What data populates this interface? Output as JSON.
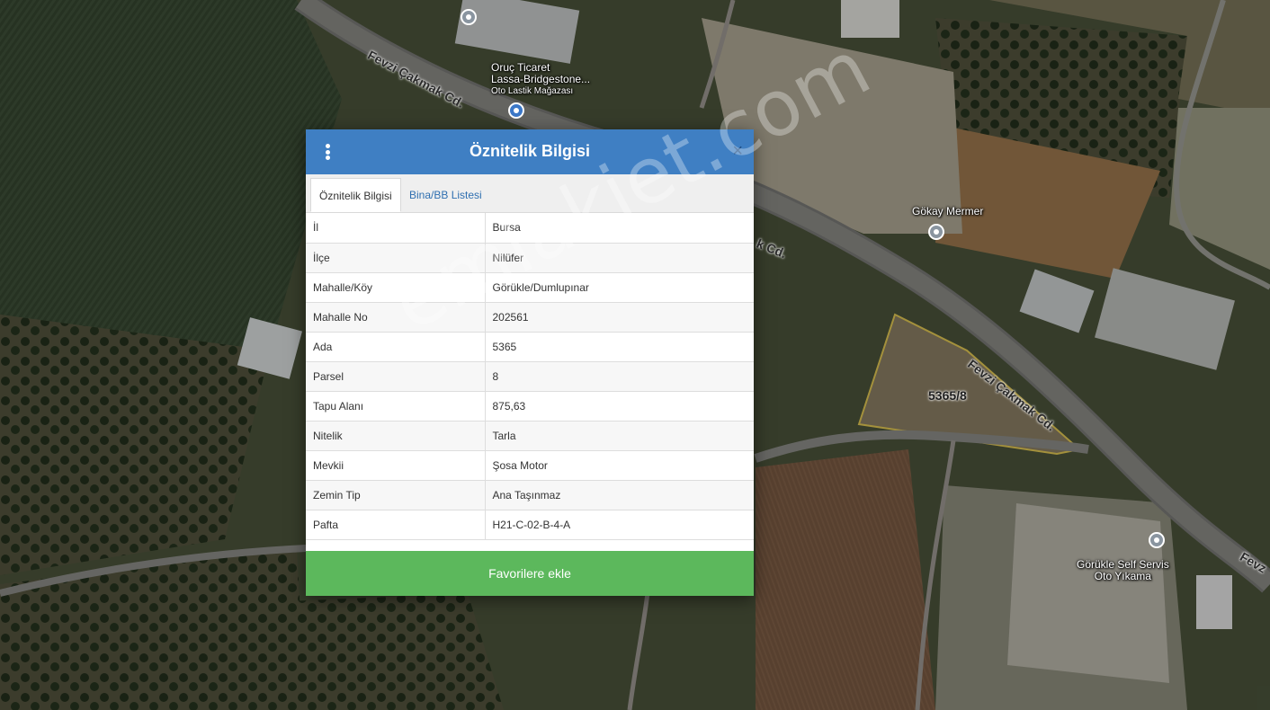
{
  "dialog": {
    "title": "Öznitelik Bilgisi",
    "menu_icon": "kebab-menu-icon",
    "close_label": "×",
    "tabs": [
      {
        "label": "Öznitelik Bilgisi",
        "active": true
      },
      {
        "label": "Bina/BB Listesi",
        "active": false
      }
    ],
    "rows": [
      {
        "key": "İl",
        "value": "Bursa"
      },
      {
        "key": "İlçe",
        "value": "Nilüfer"
      },
      {
        "key": "Mahalle/Köy",
        "value": "Görükle/Dumlupınar"
      },
      {
        "key": "Mahalle No",
        "value": "202561"
      },
      {
        "key": "Ada",
        "value": "5365"
      },
      {
        "key": "Parsel",
        "value": "8"
      },
      {
        "key": "Tapu Alanı",
        "value": "875,63"
      },
      {
        "key": "Nitelik",
        "value": "Tarla"
      },
      {
        "key": "Mevkii",
        "value": "Şosa Motor"
      },
      {
        "key": "Zemin Tip",
        "value": "Ana Taşınmaz"
      },
      {
        "key": "Pafta",
        "value": "H21-C-02-B-4-A"
      }
    ],
    "favorite_button": "Favorilere ekle"
  },
  "map": {
    "labels": {
      "poi_oruc_1": "Oruç Ticaret",
      "poi_oruc_2": "Lassa-Bridgestone...",
      "poi_oruc_3": "Oto Lastik Mağazası",
      "poi_gokay": "Gökay Mermer",
      "poi_gorukle_1": "Görükle Self Servis",
      "poi_gorukle_2": "Oto Yıkama",
      "road_top": "Fevzi Çakmak Cd.",
      "road_right": "Fevzi Çakmak Cd.",
      "road_far_right": "Fevz",
      "road_mid": "k Cd.",
      "parcel": "5365/8"
    }
  },
  "watermark": "emlakjet.com",
  "colors": {
    "header": "#3f7fc3",
    "favorite": "#5cb85c",
    "tab_link": "#2f6fb0",
    "parcel_outline": "#c9b14a"
  }
}
